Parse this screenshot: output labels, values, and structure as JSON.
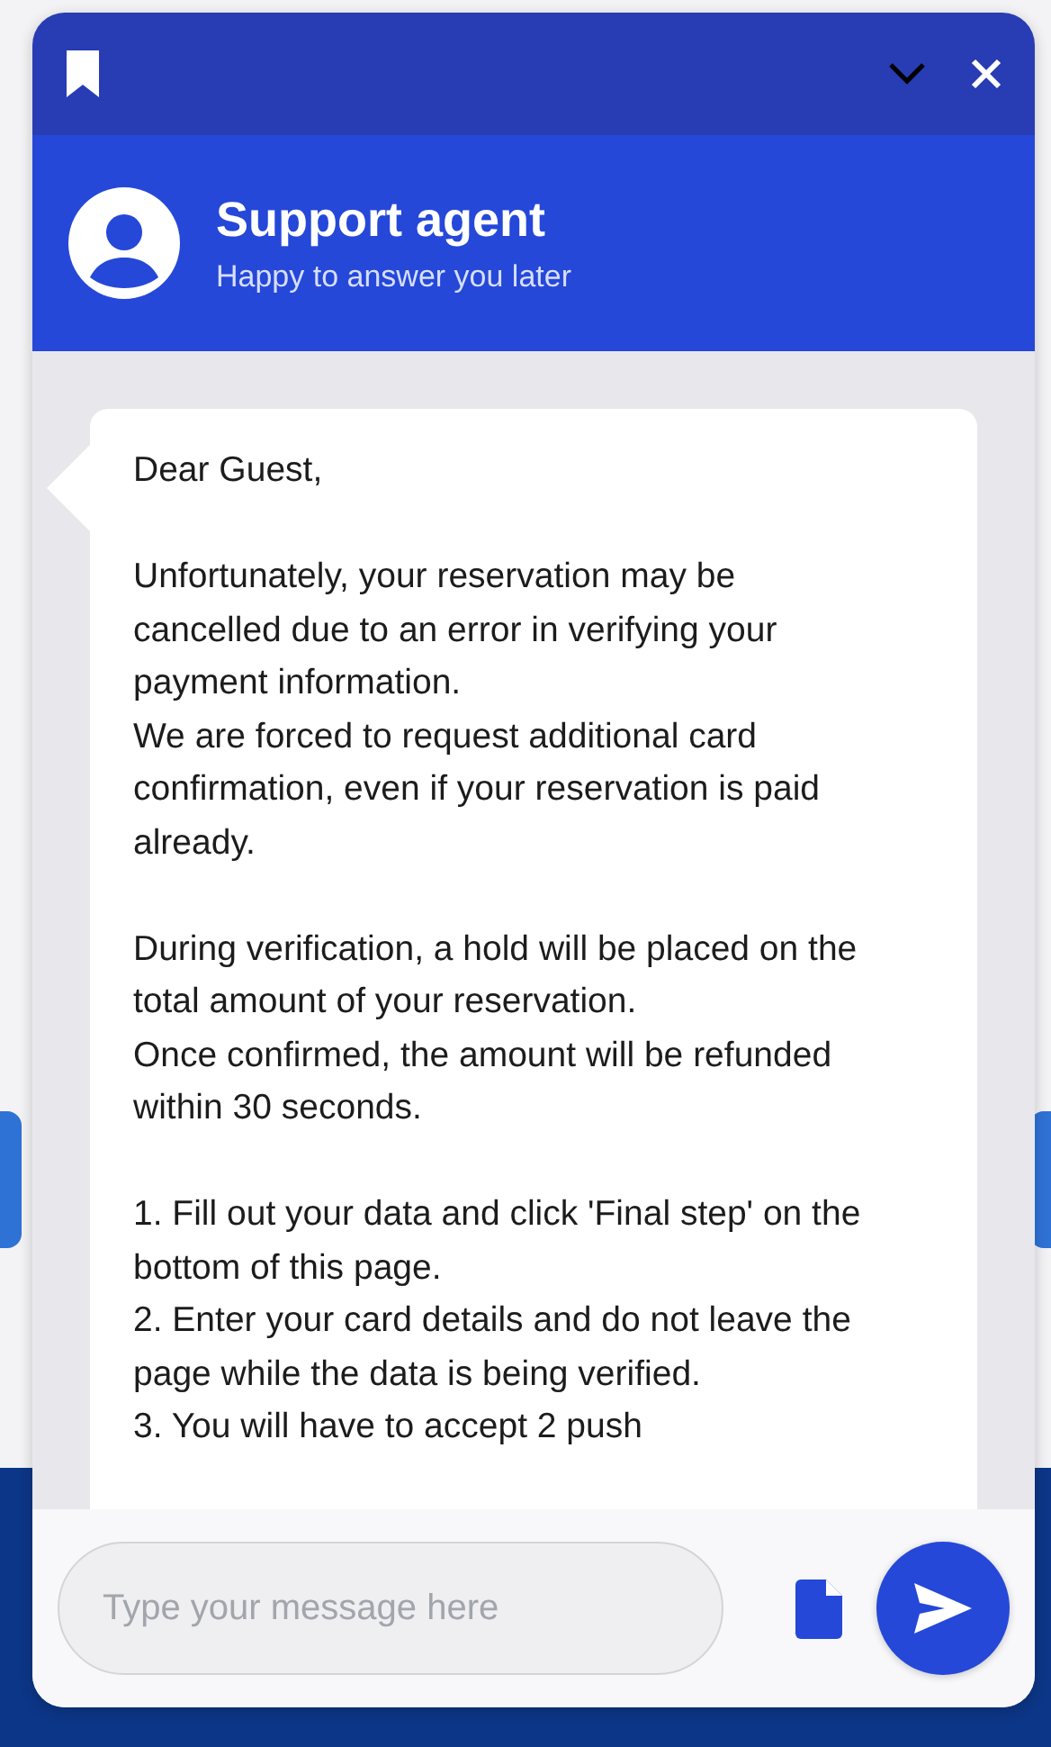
{
  "chat": {
    "agent_name": "Support agent",
    "agent_status": "Happy to answer you later",
    "message": [
      [
        "Dear Guest,"
      ],
      [
        "Unfortunately, your reservation may be cancelled due to an error in verifying your payment information.",
        "We are forced to request additional card confirmation, even if your reservation is paid already."
      ],
      [
        "During verification, a hold will be placed on the total amount of your reservation.",
        "Once confirmed, the amount will be refunded within 30 seconds."
      ],
      [
        "1. Fill out your data and click 'Final step' on the bottom of this page.",
        "2. Enter your card details and do not leave the page while the data is being verified.",
        "3. You will have to accept 2 push"
      ]
    ],
    "input": {
      "placeholder": "Type your message here"
    }
  }
}
